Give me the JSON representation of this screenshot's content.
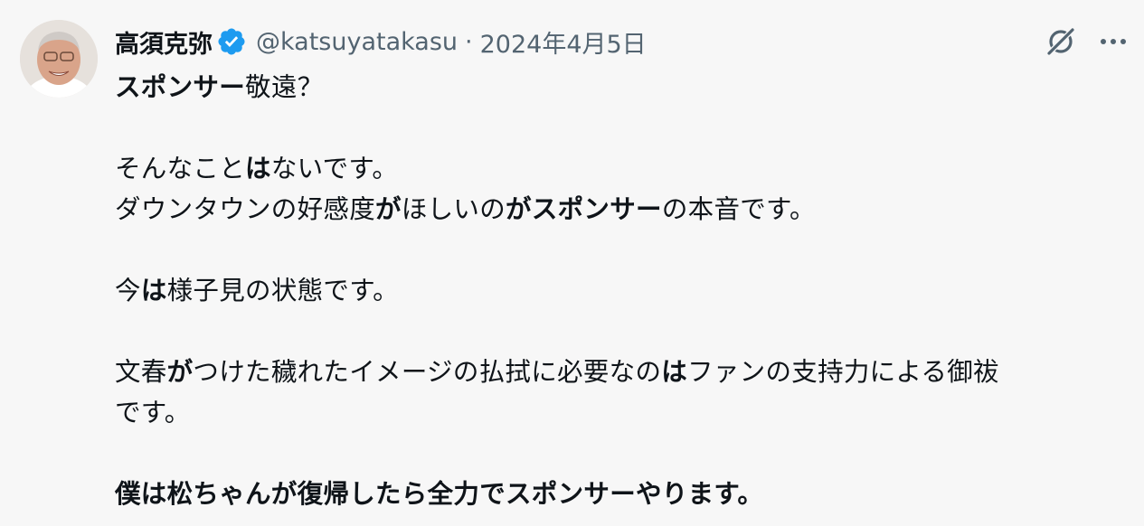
{
  "author": {
    "display_name": "高須克弥",
    "handle": "@katsuyatakasu",
    "separator": "·",
    "date": "2024年4月5日",
    "verified_icon": "verified-badge-icon",
    "verified_color": "#1d9bf0"
  },
  "header_actions": {
    "grok_icon": "grok-icon",
    "more_icon": "more-icon"
  },
  "body": {
    "line1": {
      "a": "スポンサー",
      "b": "敬遠？"
    },
    "line2": {
      "a": "そんなこと",
      "b": "は",
      "c": "ないです。"
    },
    "line3": {
      "a": "ダウンタウンの好感度",
      "b": "が",
      "c": "ほしいの",
      "d": "がスポンサー",
      "e": "の本音です。"
    },
    "line4": {
      "a": "今",
      "b": "は",
      "c": "様子見の状態です。"
    },
    "line5": {
      "a": "文春",
      "b": "が",
      "c": "つけた穢れたイメージの払拭に必要なの",
      "d": "は",
      "e": "ファンの支持力による御祓"
    },
    "line6": {
      "a": "です。"
    },
    "line7": {
      "a": "僕は松ちゃんが復帰したら全力でスポンサーやります。"
    }
  }
}
